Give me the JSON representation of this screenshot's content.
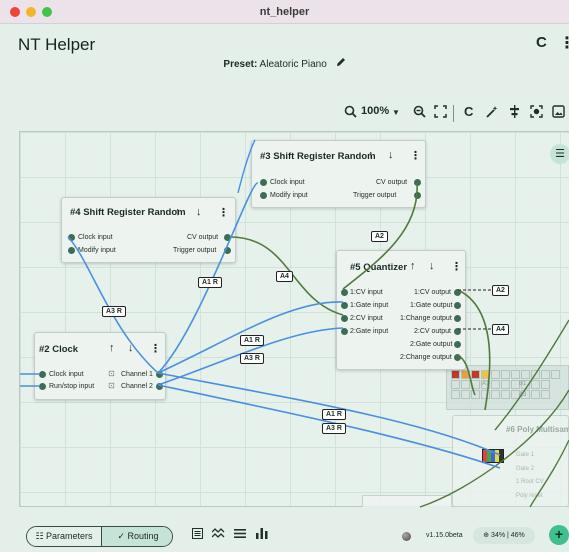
{
  "window": {
    "title": "nt_helper"
  },
  "app": {
    "title": "NT Helper",
    "refresh_icon": "C",
    "more_icon": "⋮"
  },
  "preset": {
    "label": "Preset:",
    "name": "Aleatoric Piano"
  },
  "toolbar": {
    "zoom": "100%"
  },
  "nodes": {
    "shift3": {
      "title": "#3 Shift Register Random",
      "inputs": [
        "Clock input",
        "Modify input"
      ],
      "outputs": [
        "CV output",
        "Trigger output"
      ]
    },
    "shift4": {
      "title": "#4 Shift Register Random",
      "inputs": [
        "Clock input",
        "Modify input"
      ],
      "outputs": [
        "CV output",
        "Trigger output"
      ]
    },
    "quant5": {
      "title": "#5 Quantizer",
      "inputs": [
        "1:CV input",
        "1:Gate input",
        "2:CV input",
        "2:Gate input"
      ],
      "outputs": [
        "1:CV output",
        "1:Gate output",
        "1:Change output",
        "2:CV output",
        "2:Gate output",
        "2:Change output"
      ]
    },
    "clock2": {
      "title": "#2 Clock",
      "inputs": [
        "Clock input",
        "Run/stop input"
      ],
      "outputs": [
        "Channel 1",
        "Channel 2"
      ]
    },
    "poly": {
      "title": "#6 Poly Multisam",
      "inputs": [
        "Gate 1",
        "Gate 2",
        "1 Root CV",
        "Poly reset"
      ]
    }
  },
  "controls": {
    "up": "↑",
    "down": "↓",
    "more": "⋮"
  },
  "wire_labels": {
    "a1r": "A1 R",
    "a3r": "A3 R",
    "a2": "A2",
    "a4": "A4"
  },
  "mini_labels": {
    "a1": "A1",
    "a3": "A3",
    "b1": "B1"
  },
  "bottom": {
    "params_label": "Parameters",
    "routing_label": "Routing",
    "version": "v1.15.0beta",
    "cpu": "34% | 46%",
    "add_icon": "+"
  },
  "colors": {
    "accent": "#c6e3d8",
    "blue_wire": "#4a8fe0",
    "green_wire": "#4f7a3c",
    "fab": "#3fc08e"
  }
}
